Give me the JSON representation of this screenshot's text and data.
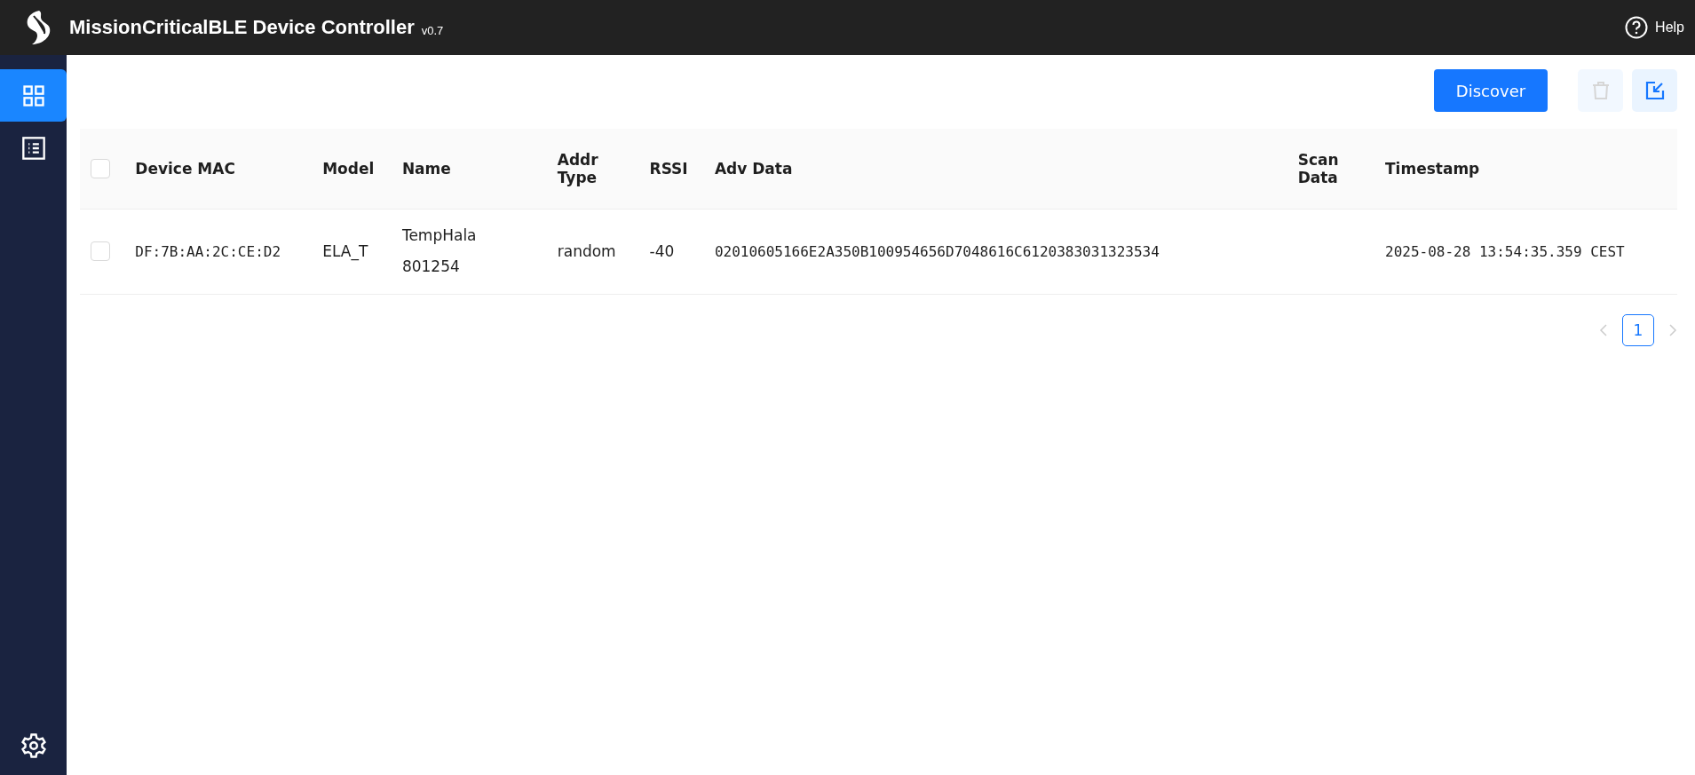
{
  "header": {
    "title": "MissionCriticalBLE Device Controller",
    "version": "v0.7",
    "help": "Help"
  },
  "sidebar": {
    "items": [
      {
        "kind": "grid",
        "selected": true
      },
      {
        "kind": "list",
        "selected": false
      }
    ]
  },
  "toolbar": {
    "discover": "Discover",
    "delete_disabled": true
  },
  "table": {
    "all_checked": false,
    "columns": [
      "Device MAC",
      "Model",
      "Name",
      "Addr Type",
      "RSSI",
      "Adv Data",
      "Scan Data",
      "Timestamp"
    ],
    "rows": [
      {
        "checked": false,
        "cells": [
          "DF:7B:AA:2C:CE:D2",
          "ELA_T",
          "TempHala 801254",
          "random",
          "-40",
          "02010605166E2A350B100954656D7048616C6120383031323534",
          "",
          "2025-08-28 13:54:35.359 CEST"
        ]
      }
    ]
  },
  "pagination": {
    "pages": [
      {
        "label": "1",
        "selected": true
      }
    ]
  }
}
